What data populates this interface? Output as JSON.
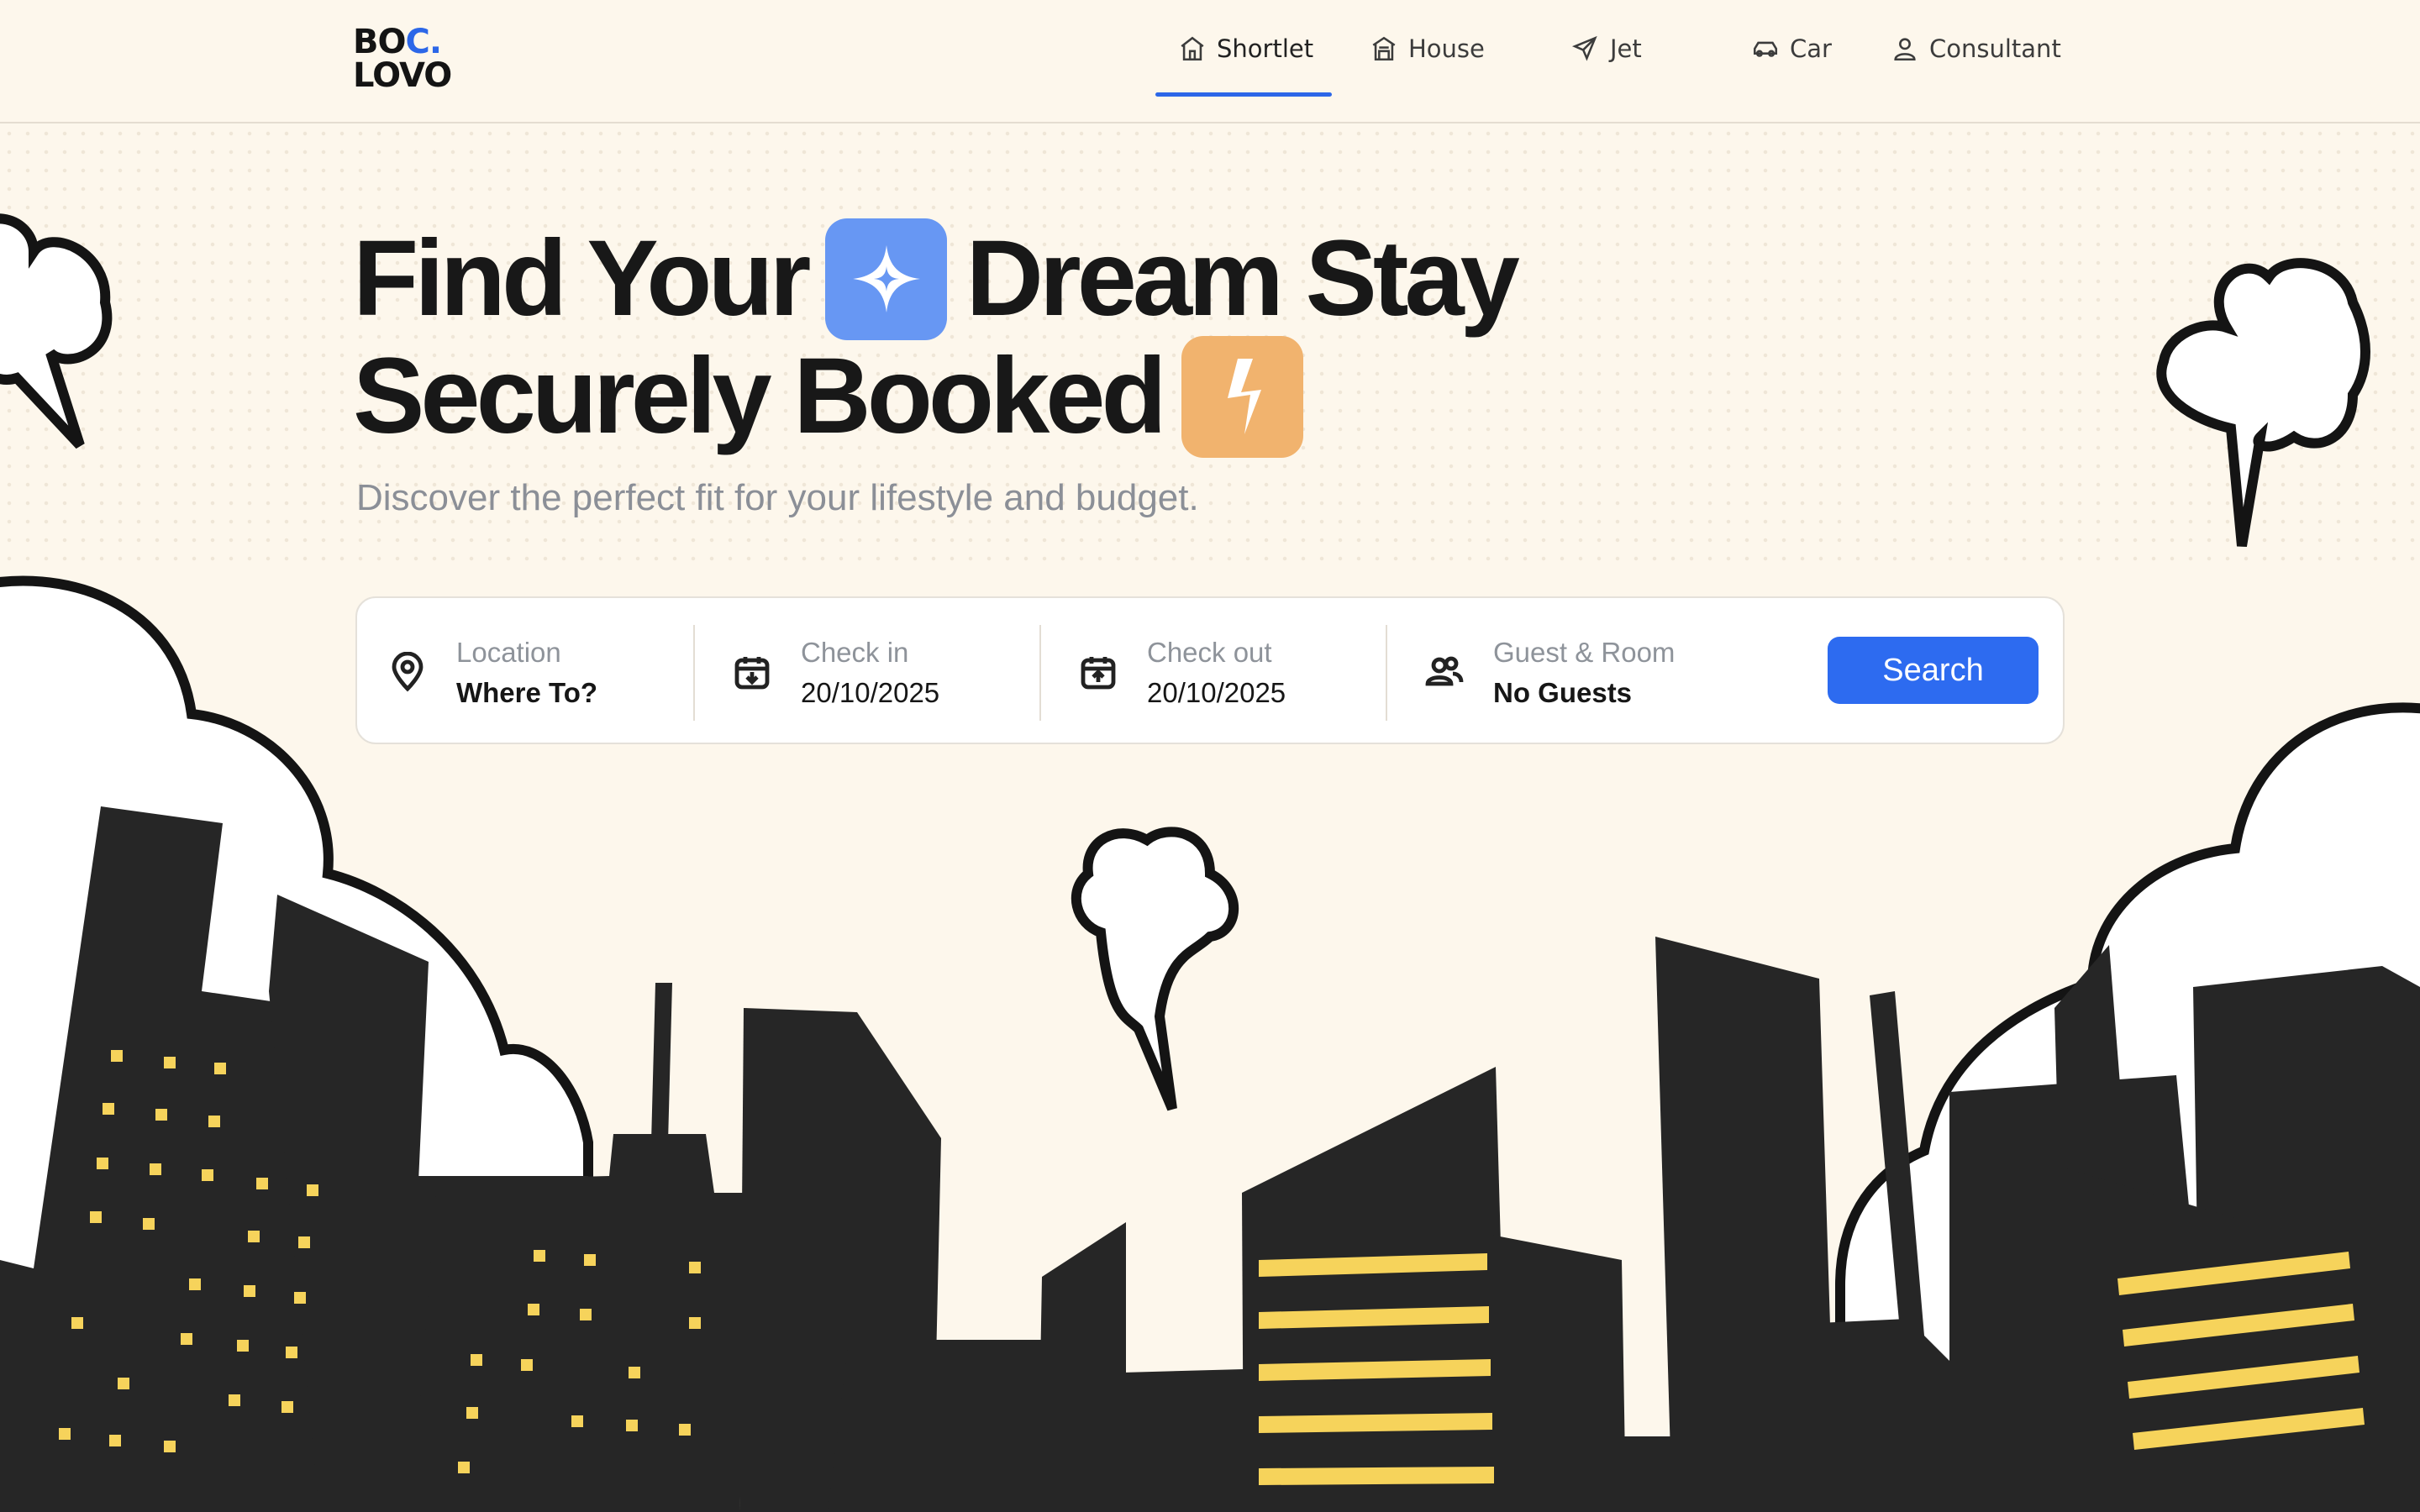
{
  "brand": {
    "line1": "BO",
    "line1_accent": "C.",
    "line2": "LOVO"
  },
  "nav": {
    "items": [
      {
        "label": "Shortlet",
        "icon": "home-icon",
        "active": true
      },
      {
        "label": "House",
        "icon": "house-icon",
        "active": false
      },
      {
        "label": "Jet",
        "icon": "plane-icon",
        "active": false
      },
      {
        "label": "Car",
        "icon": "car-icon",
        "active": false
      },
      {
        "label": "Consultant",
        "icon": "person-icon",
        "active": false
      }
    ],
    "accent": "#2c67e8"
  },
  "hero": {
    "line1_a": "Find Your",
    "line1_b": "Dream Stay",
    "line2": "Securely Booked",
    "subtitle": "Discover the perfect fit for your lifestyle and budget.",
    "badge1_icon": "sparkle-icon",
    "badge1_color": "#6797f3",
    "badge2_icon": "lightning-icon",
    "badge2_color": "#f1b36e"
  },
  "search": {
    "location": {
      "label": "Location",
      "value": "Where To?",
      "icon": "location-pin-icon"
    },
    "checkin": {
      "label": "Check in",
      "value": "20/10/2025",
      "icon": "calendar-down-icon"
    },
    "checkout": {
      "label": "Check out",
      "value": "20/10/2025",
      "icon": "calendar-up-icon"
    },
    "guests": {
      "label": "Guest & Room",
      "value": "No Guests",
      "icon": "users-icon"
    },
    "button_label": "Search",
    "button_color": "#2d6bf0"
  },
  "colors": {
    "background": "#fdf7ec",
    "building": "#262626",
    "window": "#f6d35b"
  }
}
